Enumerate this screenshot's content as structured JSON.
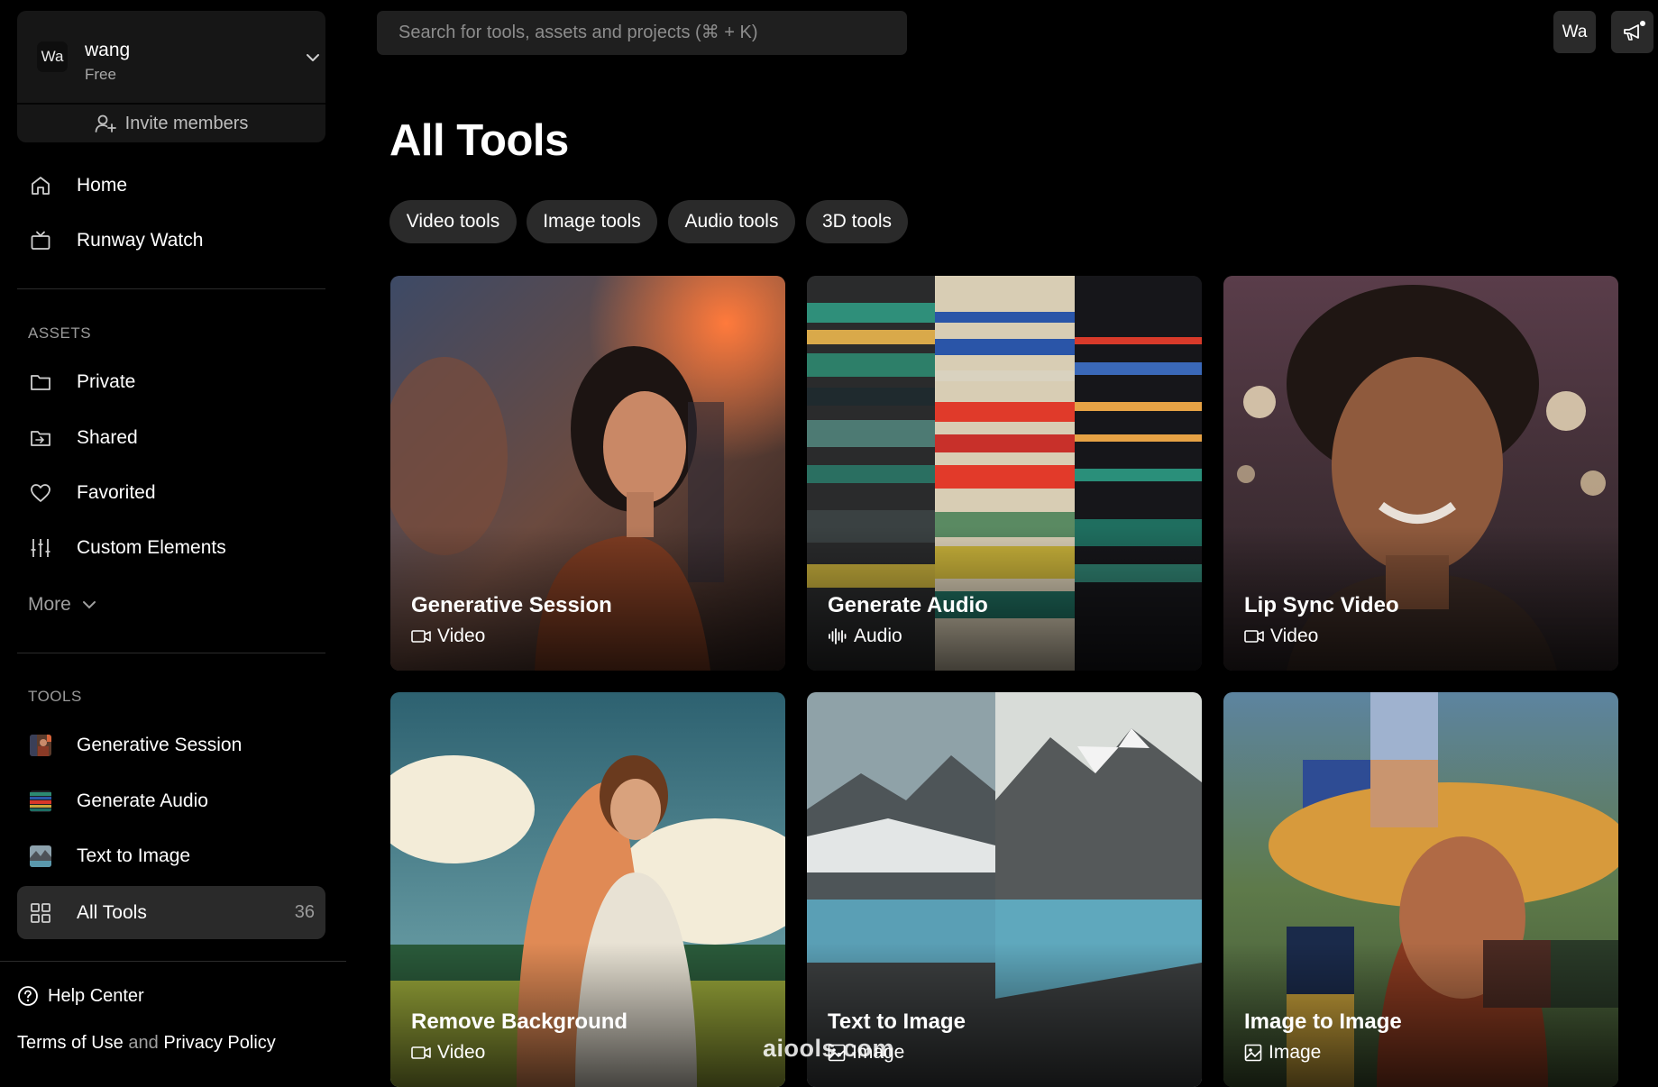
{
  "account": {
    "avatar_initials": "Wa",
    "name": "wang",
    "plan": "Free",
    "invite_label": "Invite members"
  },
  "nav": {
    "home": "Home",
    "watch": "Runway Watch"
  },
  "assets": {
    "section_label": "ASSETS",
    "private": "Private",
    "shared": "Shared",
    "favorited": "Favorited",
    "custom_elements": "Custom Elements",
    "more": "More"
  },
  "tools_nav": {
    "section_label": "TOOLS",
    "generative_session": "Generative Session",
    "generate_audio": "Generate Audio",
    "text_to_image": "Text to Image",
    "all_tools": "All Tools",
    "all_tools_count": "36"
  },
  "footer": {
    "help": "Help Center",
    "terms": "Terms of Use",
    "and": "and",
    "privacy": "Privacy Policy"
  },
  "topbar": {
    "search_placeholder": "Search for tools, assets and projects (⌘ + K)",
    "avatar_initials": "Wa"
  },
  "main": {
    "title": "All Tools",
    "filters": [
      "Video tools",
      "Image tools",
      "Audio tools",
      "3D tools"
    ],
    "cards": [
      {
        "title": "Generative Session",
        "type": "Video",
        "type_icon": "video-camera-icon"
      },
      {
        "title": "Generate Audio",
        "type": "Audio",
        "type_icon": "audio-wave-icon"
      },
      {
        "title": "Lip Sync Video",
        "type": "Video",
        "type_icon": "video-camera-icon"
      },
      {
        "title": "Remove Background",
        "type": "Video",
        "type_icon": "video-camera-icon"
      },
      {
        "title": "Text to Image",
        "type": "Image",
        "type_icon": "image-icon"
      },
      {
        "title": "Image to Image",
        "type": "Image",
        "type_icon": "image-icon"
      }
    ]
  },
  "watermark": "aiools.com",
  "colors": {
    "background": "#000000",
    "panel": "#161616",
    "chip": "#2a2a2a",
    "active_nav": "#2a2a2a",
    "muted_text": "#9a9a9a"
  }
}
